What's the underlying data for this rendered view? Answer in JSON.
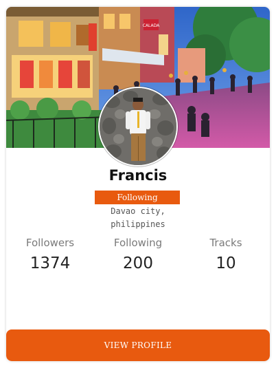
{
  "profile": {
    "name": "Francis",
    "status_badge": "Following",
    "location": "Davao city,\nphilippines"
  },
  "stats": [
    {
      "label": "Followers",
      "value": "1374"
    },
    {
      "label": "Following",
      "value": "200"
    },
    {
      "label": "Tracks",
      "value": "10"
    }
  ],
  "actions": {
    "view_profile": "VIEW PROFILE"
  },
  "colors": {
    "accent": "#e85a0f"
  },
  "cover": {
    "sign_text": "CALADA"
  }
}
